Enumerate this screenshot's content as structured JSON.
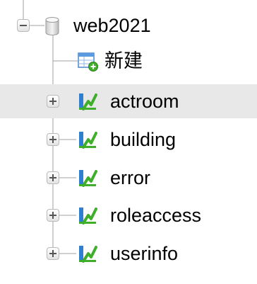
{
  "tree": {
    "root": {
      "label": "web2021",
      "icon": "database-icon",
      "expanded": true
    },
    "new_item": {
      "label": "新建",
      "icon": "new-table-icon"
    },
    "tables": [
      {
        "label": "actroom",
        "icon": "table-icon",
        "expanded": false,
        "selected": true
      },
      {
        "label": "building",
        "icon": "table-icon",
        "expanded": false,
        "selected": false
      },
      {
        "label": "error",
        "icon": "table-icon",
        "expanded": false,
        "selected": false
      },
      {
        "label": "roleaccess",
        "icon": "table-icon",
        "expanded": false,
        "selected": false
      },
      {
        "label": "userinfo",
        "icon": "table-icon",
        "expanded": false,
        "selected": false
      }
    ],
    "colors": {
      "selection": "#e8e8e8",
      "tree_line": "#a0a0a0",
      "icon_green": "#3fae2a",
      "icon_blue": "#2f7fd0"
    }
  }
}
